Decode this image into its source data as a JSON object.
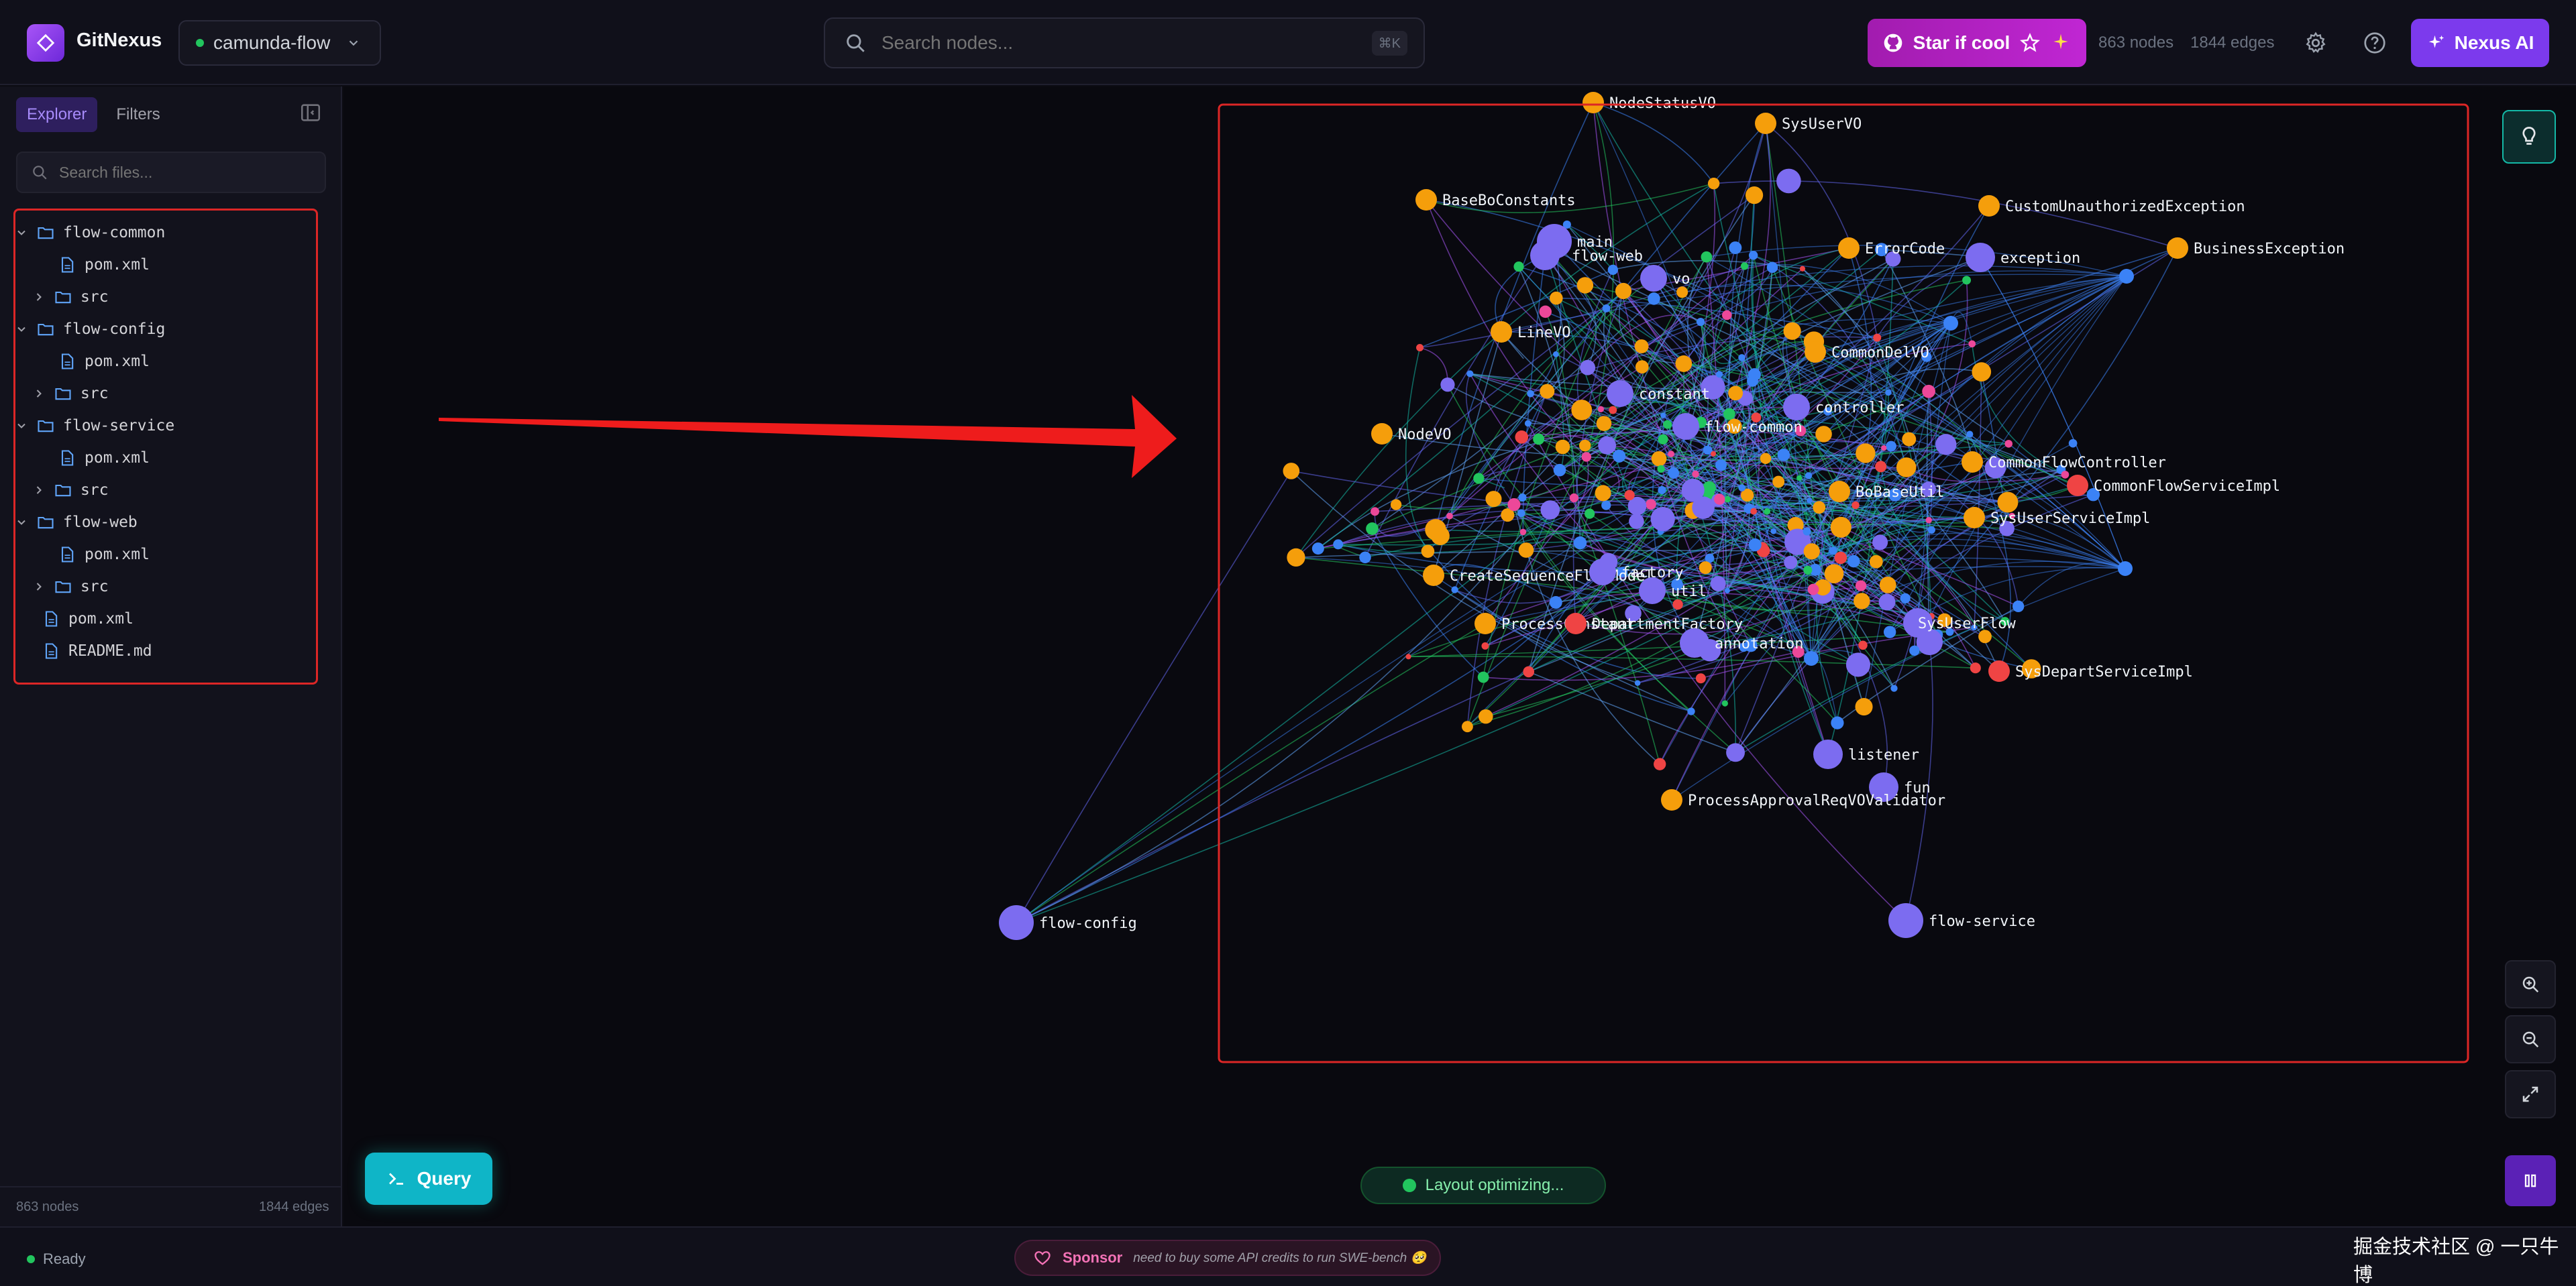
{
  "app": {
    "title": "GitNexus"
  },
  "repo": {
    "name": "camunda-flow"
  },
  "search": {
    "placeholder": "Search nodes...",
    "shortcut": "⌘K"
  },
  "header": {
    "star_label": "Star if cool",
    "nodes_count": "863 nodes",
    "edges_count": "1844 edges",
    "nexus_label": "Nexus AI"
  },
  "sidebar": {
    "tabs": [
      "Explorer",
      "Filters"
    ],
    "file_search_placeholder": "Search files...",
    "tree": [
      {
        "label": "flow-common",
        "type": "folder",
        "expanded": true,
        "level": 0
      },
      {
        "label": "pom.xml",
        "type": "file",
        "level": 1
      },
      {
        "label": "src",
        "type": "folder",
        "expanded": false,
        "level": 1
      },
      {
        "label": "flow-config",
        "type": "folder",
        "expanded": true,
        "level": 0
      },
      {
        "label": "pom.xml",
        "type": "file",
        "level": 1
      },
      {
        "label": "src",
        "type": "folder",
        "expanded": false,
        "level": 1
      },
      {
        "label": "flow-service",
        "type": "folder",
        "expanded": true,
        "level": 0
      },
      {
        "label": "pom.xml",
        "type": "file",
        "level": 1
      },
      {
        "label": "src",
        "type": "folder",
        "expanded": false,
        "level": 1
      },
      {
        "label": "flow-web",
        "type": "folder",
        "expanded": true,
        "level": 0
      },
      {
        "label": "pom.xml",
        "type": "file",
        "level": 1
      },
      {
        "label": "src",
        "type": "folder",
        "expanded": false,
        "level": 1
      },
      {
        "label": "pom.xml",
        "type": "file",
        "level": 0
      },
      {
        "label": "README.md",
        "type": "file",
        "level": 0
      }
    ],
    "footer_nodes": "863 nodes",
    "footer_edges": "1844 edges"
  },
  "graph": {
    "labels": [
      "NodeStatusVO",
      "SysUserVO",
      "BaseBoConstants",
      "CustomUnauthorizedException",
      "main",
      "flow-web",
      "ErrorCode",
      "exception",
      "BusinessException",
      "vo",
      "LineVO",
      "CommonDelVO",
      "constant",
      "controller",
      "NodeVO",
      "flow-common",
      "CommonFlowController",
      "BoBaseUtil",
      "CommonFlowServiceImpl",
      "SysUserServiceImpl",
      "CreateSequenceFlowModel",
      "factory",
      "util",
      "ProcessConstant",
      "DepartmentFactory",
      "SysUserFlow",
      "annotation",
      "SysDepartServiceImpl",
      "listener",
      "fun",
      "ProcessApprovalReqVOValidator",
      "flow-service",
      "flow-config"
    ],
    "colors": {
      "folder": "#7c6cf0",
      "class": "#f59e0b",
      "file": "#3b82f6",
      "interface": "#ef4444",
      "enum": "#22c55e",
      "method": "#ec4899",
      "highlight": "#dc2626"
    }
  },
  "canvas": {
    "query_label": "Query",
    "layout_status": "Layout optimizing..."
  },
  "status": {
    "ready": "Ready",
    "sponsor_label": "Sponsor",
    "sponsor_text": "need to buy some API credits to run SWE-bench 🥺"
  },
  "watermark": "掘金技术社区 @ 一只牛博"
}
